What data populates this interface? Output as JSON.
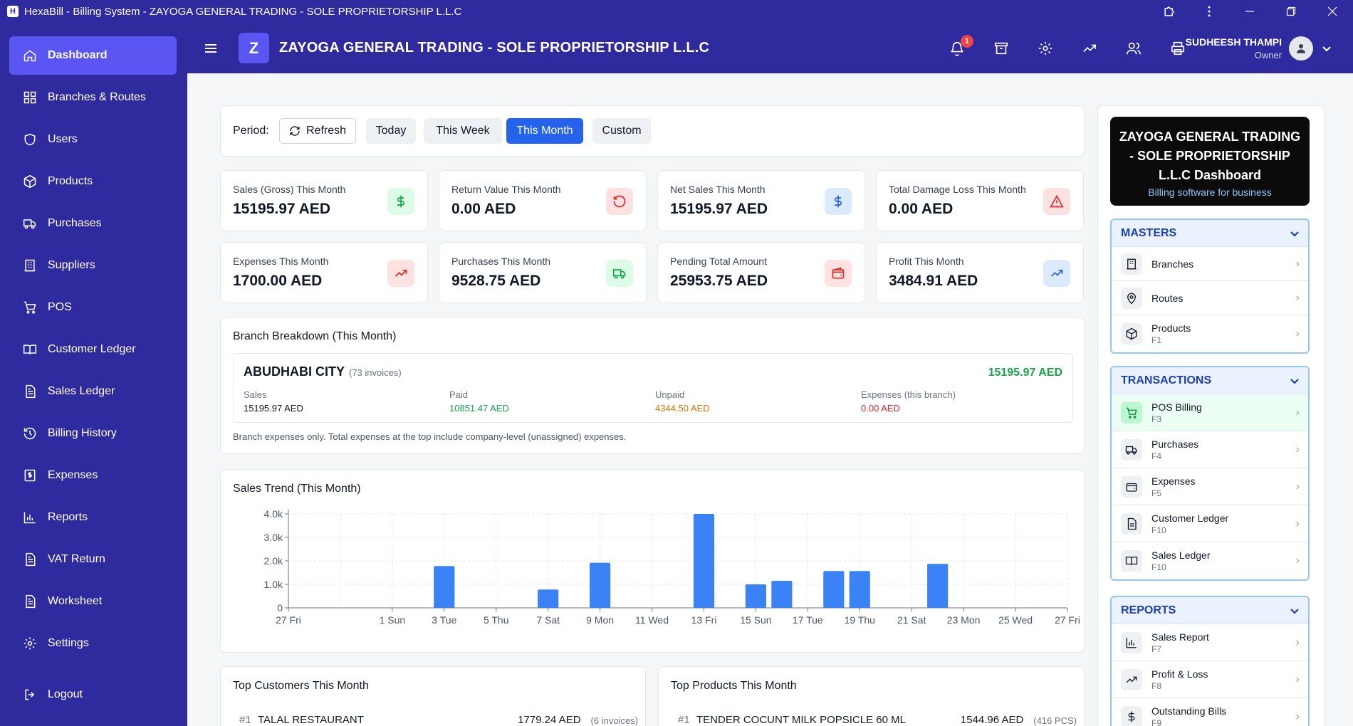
{
  "window": {
    "title": "HexaBill - Billing System - ZAYOGA GENERAL TRADING - SOLE PROPRIETORSHIP L.L.C",
    "app_icon": "H"
  },
  "sidebar": {
    "items": [
      {
        "label": "Dashboard",
        "icon": "home-icon",
        "active": true
      },
      {
        "label": "Branches & Routes",
        "icon": "grid-icon"
      },
      {
        "label": "Users",
        "icon": "shield-icon"
      },
      {
        "label": "Products",
        "icon": "box-icon"
      },
      {
        "label": "Purchases",
        "icon": "truck-icon"
      },
      {
        "label": "Suppliers",
        "icon": "building-icon"
      },
      {
        "label": "POS",
        "icon": "cart-icon"
      },
      {
        "label": "Customer Ledger",
        "icon": "book-icon"
      },
      {
        "label": "Sales Ledger",
        "icon": "document-icon"
      },
      {
        "label": "Billing History",
        "icon": "history-icon"
      },
      {
        "label": "Expenses",
        "icon": "dollar-file-icon"
      },
      {
        "label": "Reports",
        "icon": "bar-chart-icon"
      },
      {
        "label": "VAT Return",
        "icon": "document-icon"
      },
      {
        "label": "Worksheet",
        "icon": "document-icon"
      },
      {
        "label": "Settings",
        "icon": "gear-icon"
      }
    ],
    "logout": "Logout"
  },
  "header": {
    "badge": "Z",
    "company": "ZAYOGA GENERAL TRADING - SOLE PROPRIETORSHIP L.L.C",
    "notifications": "1",
    "user_name": "SUDHEESH THAMPI",
    "user_role": "Owner"
  },
  "period": {
    "label": "Period:",
    "refresh": "Refresh",
    "options": [
      "Today",
      "This Week",
      "This Month",
      "Custom"
    ],
    "selected": "This Month"
  },
  "stats": [
    {
      "label": "Sales (Gross) This Month",
      "value": "15195.97 AED",
      "icon": "dollar-icon",
      "color": "#16a34a",
      "bg": "#dcfce7"
    },
    {
      "label": "Return Value This Month",
      "value": "0.00 AED",
      "icon": "rotate-icon",
      "color": "#dc2626",
      "bg": "#fee2e2"
    },
    {
      "label": "Net Sales This Month",
      "value": "15195.97 AED",
      "icon": "dollar-icon",
      "color": "#2563eb",
      "bg": "#dbeafe"
    },
    {
      "label": "Total Damage Loss This Month",
      "value": "0.00 AED",
      "icon": "warning-icon",
      "color": "#dc2626",
      "bg": "#fee2e2"
    },
    {
      "label": "Expenses This Month",
      "value": "1700.00 AED",
      "icon": "trend-up-icon",
      "color": "#dc2626",
      "bg": "#fee2e2"
    },
    {
      "label": "Purchases This Month",
      "value": "9528.75 AED",
      "icon": "truck-icon",
      "color": "#16a34a",
      "bg": "#dcfce7"
    },
    {
      "label": "Pending Total Amount",
      "value": "25953.75 AED",
      "icon": "wallet-icon",
      "color": "#dc2626",
      "bg": "#fee2e2"
    },
    {
      "label": "Profit This Month",
      "value": "3484.91 AED",
      "icon": "trend-up-icon",
      "color": "#2563eb",
      "bg": "#dbeafe"
    }
  ],
  "branch": {
    "title": "Branch Breakdown (This Month)",
    "name": "ABUDHABI CITY",
    "invoices": "(73 invoices)",
    "total": "15195.97 AED",
    "sales_label": "Sales",
    "sales": "15195.97 AED",
    "paid_label": "Paid",
    "paid": "10851.47 AED",
    "unpaid_label": "Unpaid",
    "unpaid": "4344.50 AED",
    "exp_label": "Expenses (this branch)",
    "exp": "0.00 AED",
    "note": "Branch expenses only. Total expenses at the top include company-level (unassigned) expenses."
  },
  "trend": {
    "title": "Sales Trend (This Month)"
  },
  "chart_data": {
    "type": "bar",
    "title": "Sales Trend (This Month)",
    "color": "#3b82f6",
    "categories": [
      "27 Fri",
      "28 Sat",
      "29 Sun",
      "30 Mon",
      "1 Sun",
      "2 Mon",
      "3 Tue",
      "4 Wed",
      "5 Thu",
      "6 Fri",
      "7 Sat",
      "8 Sun",
      "9 Mon",
      "10 Tue",
      "11 Wed",
      "12 Thu",
      "13 Fri",
      "14 Sat",
      "15 Sun",
      "16 Mon",
      "17 Tue",
      "18 Wed",
      "19 Thu",
      "20 Fri",
      "21 Sat",
      "22 Sun",
      "23 Mon",
      "24 Tue",
      "25 Wed",
      "26 Thu",
      "27 Fri"
    ],
    "tick_labels": [
      "27 Fri",
      "1 Sun",
      "3 Tue",
      "5 Thu",
      "7 Sat",
      "9 Mon",
      "11 Wed",
      "13 Fri",
      "15 Sun",
      "17 Tue",
      "19 Thu",
      "21 Sat",
      "23 Mon",
      "25 Wed",
      "27 Fri"
    ],
    "values": [
      0,
      0,
      0,
      0,
      0,
      0,
      1780,
      0,
      0,
      0,
      780,
      0,
      1920,
      0,
      0,
      0,
      4000,
      0,
      1000,
      1150,
      0,
      1570,
      1570,
      0,
      0,
      1870,
      0,
      0,
      0,
      0,
      0
    ],
    "y_ticks": [
      "0",
      "1.0k",
      "2.0k",
      "3.0k",
      "4.0k"
    ],
    "ylim": [
      0,
      4000
    ],
    "grid": true
  },
  "top_customers": {
    "title": "Top Customers This Month",
    "rows": [
      {
        "rank": "#1",
        "name": "TALAL RESTAURANT",
        "amount": "1779.24 AED",
        "meta": "(6 invoices)"
      }
    ]
  },
  "top_products": {
    "title": "Top Products This Month",
    "rows": [
      {
        "rank": "#1",
        "name": "TENDER COCUNT MILK POPSICLE 60 ML",
        "amount": "1544.96 AED",
        "meta": "(416 PCS)"
      }
    ]
  },
  "right_panel": {
    "hero_title": "ZAYOGA GENERAL TRADING - SOLE PROPRIETORSHIP L.L.C Dashboard",
    "hero_sub": "Billing software for business",
    "masters": {
      "title": "MASTERS",
      "items": [
        {
          "label": "Branches",
          "key": "",
          "icon": "building-icon"
        },
        {
          "label": "Routes",
          "key": "",
          "icon": "pin-icon"
        },
        {
          "label": "Products",
          "key": "F1",
          "icon": "box-icon"
        }
      ]
    },
    "transactions": {
      "title": "TRANSACTIONS",
      "items": [
        {
          "label": "POS Billing",
          "key": "F3",
          "icon": "cart-icon"
        },
        {
          "label": "Purchases",
          "key": "F4",
          "icon": "truck-icon"
        },
        {
          "label": "Expenses",
          "key": "F5",
          "icon": "wallet-icon"
        },
        {
          "label": "Customer Ledger",
          "key": "F10",
          "icon": "document-icon"
        },
        {
          "label": "Sales Ledger",
          "key": "F10",
          "icon": "book-icon"
        }
      ]
    },
    "reports": {
      "title": "REPORTS",
      "items": [
        {
          "label": "Sales Report",
          "key": "F7",
          "icon": "bar-chart-icon"
        },
        {
          "label": "Profit & Loss",
          "key": "F8",
          "icon": "trend-up-icon"
        },
        {
          "label": "Outstanding Bills",
          "key": "F9",
          "icon": "dollar-icon"
        }
      ]
    }
  }
}
